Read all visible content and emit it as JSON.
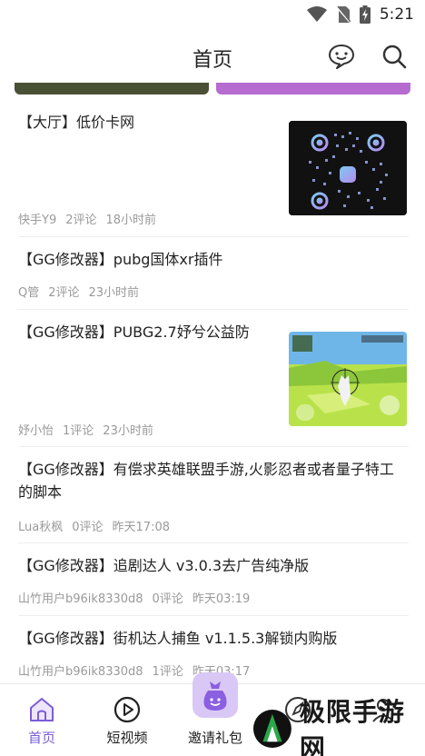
{
  "status_bar": {
    "time": "5:21",
    "icons": [
      "wifi-icon",
      "no-sim-icon",
      "battery-charging-icon"
    ]
  },
  "header": {
    "title": "首页",
    "actions": [
      "chat-bubble-icon",
      "search-icon"
    ]
  },
  "banners": {
    "colors": [
      "#4a5034",
      "#b56bd0"
    ]
  },
  "posts": [
    {
      "title": "【大厅】低价卡网",
      "author": "快手Y9",
      "comments": "2评论",
      "time": "18小时前",
      "thumbnail": "qr-code-image"
    },
    {
      "title": "【GG修改器】pubg国体xr插件",
      "author": "Q管",
      "comments": "2评论",
      "time": "23小时前"
    },
    {
      "title": "【GG修改器】PUBG2.7妤兮公益防",
      "author": "妤小怡",
      "comments": "1评论",
      "time": "23小时前",
      "thumbnail": "game-screenshot-image"
    },
    {
      "title": "【GG修改器】有偿求英雄联盟手游,火影忍者或者量子特工的脚本",
      "author": "Lua秋枫",
      "comments": "0评论",
      "time": "昨天17:08"
    },
    {
      "title": "【GG修改器】追剧达人 v3.0.3去广告纯净版",
      "author": "山竹用户b96ik8330d8",
      "comments": "0评论",
      "time": "昨天03:19"
    },
    {
      "title": "【GG修改器】街机达人捕鱼 v1.1.5.3解锁内购版",
      "author": "山竹用户b96ik8330d8",
      "comments": "1评论",
      "time": "昨天03:17"
    }
  ],
  "bottom_nav": {
    "items": [
      {
        "label": "首页",
        "icon": "home-icon",
        "active": true
      },
      {
        "label": "短视频",
        "icon": "play-circle-icon"
      },
      {
        "label": "邀请礼包",
        "icon": "gift-bag-icon"
      },
      {
        "label": "",
        "icon": "compass-icon"
      },
      {
        "label": "",
        "icon": "user-icon"
      }
    ],
    "active_color": "#7b5cd6"
  },
  "watermark": {
    "text": "极限手游网"
  }
}
